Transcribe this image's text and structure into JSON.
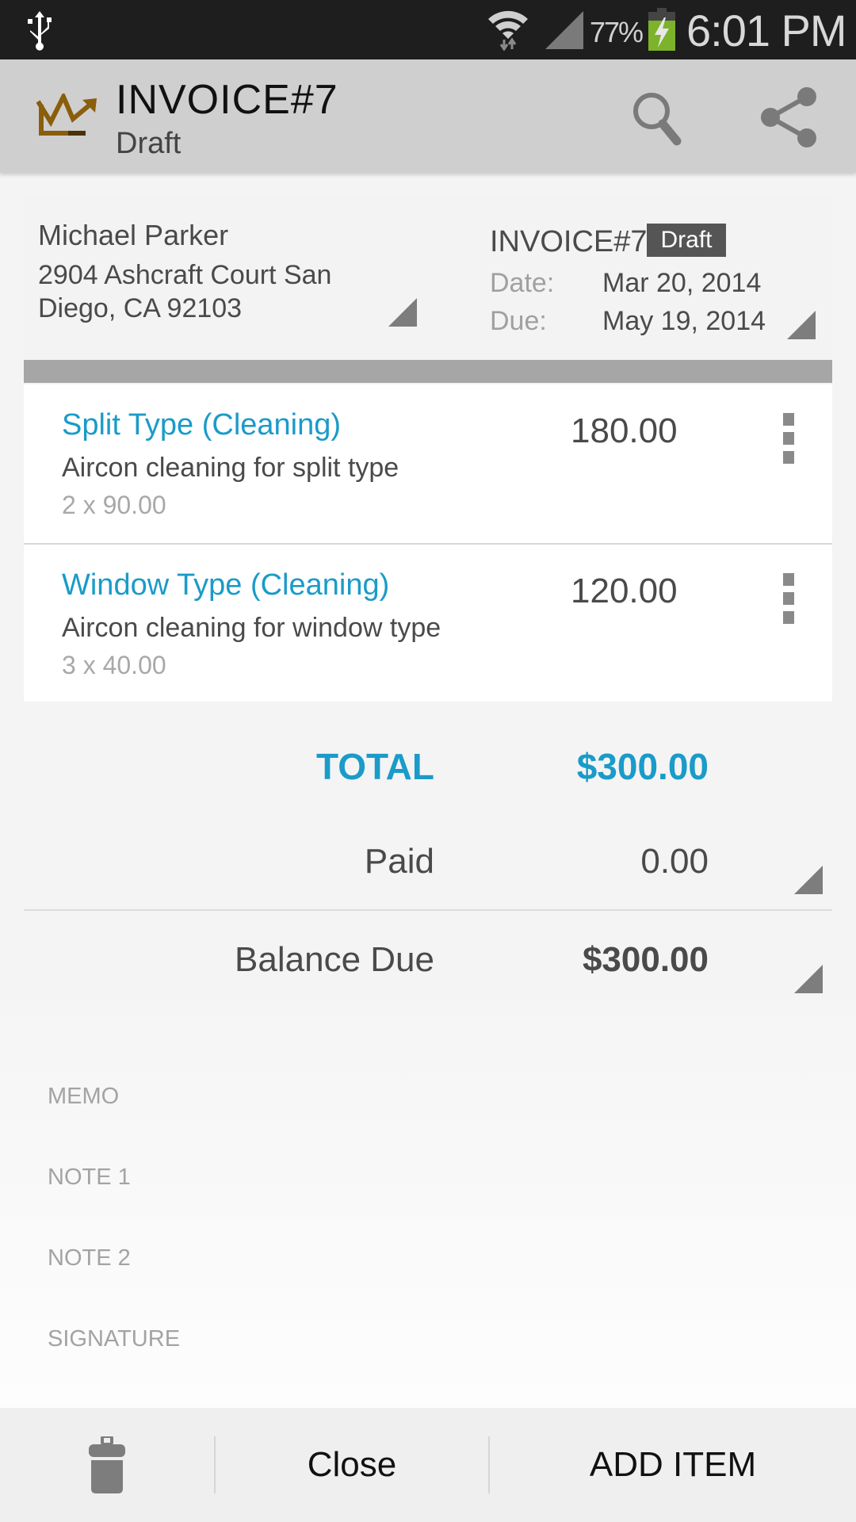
{
  "status_bar": {
    "battery_percent": "77%",
    "time": "6:01 PM",
    "icons": [
      "usb-icon",
      "wifi-icon",
      "signal-icon",
      "battery-charging-icon"
    ]
  },
  "action_bar": {
    "title": "INVOICE#7",
    "subtitle": "Draft",
    "actions": [
      "search",
      "share"
    ]
  },
  "header": {
    "client_name": "Michael Parker",
    "client_address": "2904 Ashcraft Court San Diego, CA 92103",
    "invoice_number": "INVOICE#7",
    "status_badge": "Draft",
    "date_label": "Date:",
    "date_value": "Mar 20, 2014",
    "due_label": "Due:",
    "due_value": "May 19, 2014"
  },
  "items": [
    {
      "title": "Split Type (Cleaning)",
      "description": "Aircon cleaning for split type",
      "qty_price": "2 x 90.00",
      "amount": "180.00"
    },
    {
      "title": "Window Type (Cleaning)",
      "description": "Aircon cleaning for window type",
      "qty_price": "3 x 40.00",
      "amount": "120.00"
    }
  ],
  "totals": {
    "total_label": "TOTAL",
    "total_value": "$300.00",
    "paid_label": "Paid",
    "paid_value": "0.00",
    "balance_label": "Balance Due",
    "balance_value": "$300.00"
  },
  "notes": {
    "memo": "MEMO",
    "note1": "NOTE 1",
    "note2": "NOTE 2",
    "signature": "SIGNATURE"
  },
  "bottom_bar": {
    "close_label": "Close",
    "add_item_label": "ADD ITEM"
  },
  "colors": {
    "accent": "#1a9bc9",
    "logo": "#8a5e0a",
    "battery": "#7cb32a"
  }
}
